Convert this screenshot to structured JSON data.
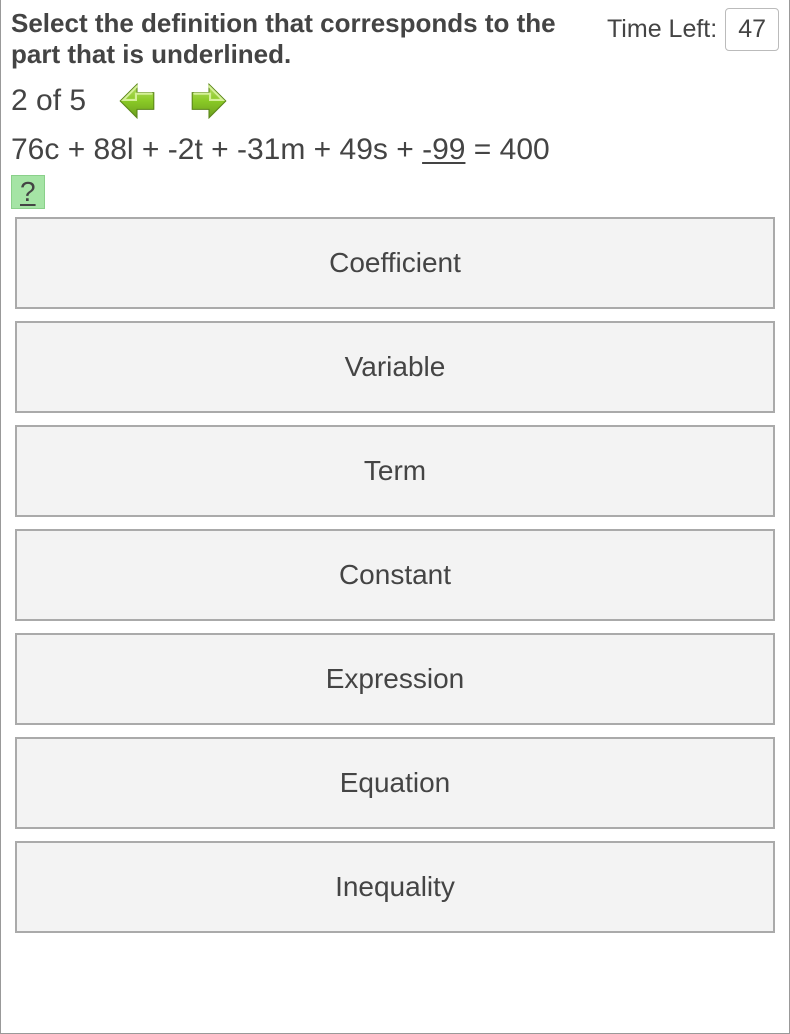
{
  "header": {
    "instruction": "Select the definition that corresponds to the part that is underlined.",
    "time_label": "Time Left:",
    "time_value": "47"
  },
  "progress": {
    "text": "2 of 5"
  },
  "equation": {
    "prefix": "76c + 88l + -2t + -31m + 49s + ",
    "underlined": "-99",
    "suffix": " = 400"
  },
  "help": {
    "label": "?"
  },
  "options": [
    {
      "label": "Coefficient"
    },
    {
      "label": "Variable"
    },
    {
      "label": "Term"
    },
    {
      "label": "Constant"
    },
    {
      "label": "Expression"
    },
    {
      "label": "Equation"
    },
    {
      "label": "Inequality"
    }
  ]
}
